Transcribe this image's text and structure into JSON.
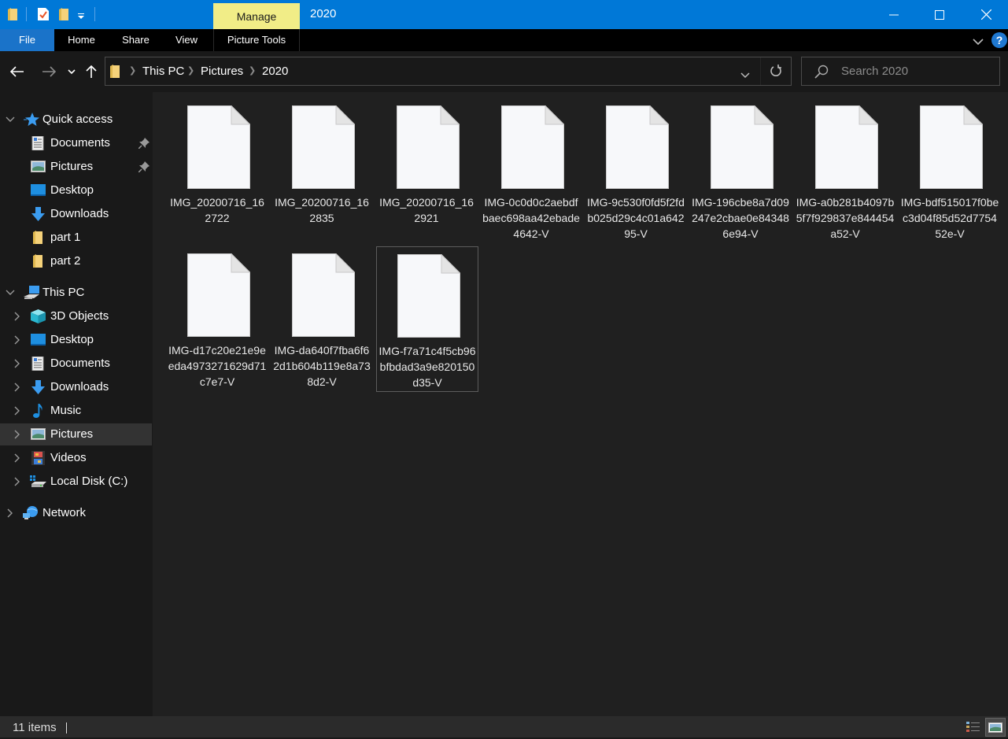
{
  "window": {
    "title": "2020",
    "contextual_tab_group": "Manage",
    "controls": {
      "minimize": "minimize",
      "maximize": "maximize",
      "close": "close"
    },
    "accent_color": "#0078d7",
    "contextual_color": "#f1ed87"
  },
  "quick_access_toolbar": {
    "icons": [
      "folder-icon",
      "properties-icon",
      "new-folder-icon",
      "customize-dropdown-icon"
    ]
  },
  "ribbon": {
    "tabs": [
      {
        "label": "File"
      },
      {
        "label": "Home"
      },
      {
        "label": "Share"
      },
      {
        "label": "View"
      },
      {
        "label": "Picture Tools"
      }
    ],
    "help_label": "?"
  },
  "navigation": {
    "back": "←",
    "forward": "→",
    "recent": "⌄",
    "up": "↑",
    "breadcrumb": [
      "This PC",
      "Pictures",
      "2020"
    ],
    "search_placeholder": "Search 2020"
  },
  "sidebar": {
    "quick_access": {
      "label": "Quick access",
      "items": [
        {
          "label": "Documents",
          "icon": "documents-icon",
          "pinned": true
        },
        {
          "label": "Pictures",
          "icon": "pictures-icon",
          "pinned": true
        },
        {
          "label": "Desktop",
          "icon": "desktop-icon",
          "pinned": false
        },
        {
          "label": "Downloads",
          "icon": "downloads-icon",
          "pinned": false
        },
        {
          "label": "part 1",
          "icon": "folder-icon",
          "pinned": false
        },
        {
          "label": "part 2",
          "icon": "folder-icon",
          "pinned": false
        }
      ]
    },
    "this_pc": {
      "label": "This PC",
      "items": [
        {
          "label": "3D Objects",
          "icon": "3d-objects-icon"
        },
        {
          "label": "Desktop",
          "icon": "desktop-icon"
        },
        {
          "label": "Documents",
          "icon": "documents-icon"
        },
        {
          "label": "Downloads",
          "icon": "downloads-icon"
        },
        {
          "label": "Music",
          "icon": "music-icon"
        },
        {
          "label": "Pictures",
          "icon": "pictures-icon",
          "selected": true
        },
        {
          "label": "Videos",
          "icon": "videos-icon"
        },
        {
          "label": "Local Disk (C:)",
          "icon": "local-disk-icon"
        }
      ]
    },
    "network": {
      "label": "Network"
    }
  },
  "files": [
    {
      "name": "IMG_20200716_162722"
    },
    {
      "name": "IMG_20200716_162835"
    },
    {
      "name": "IMG_20200716_162921"
    },
    {
      "name": "IMG-0c0d0c2aebdfbaec698aa42ebade4642-V"
    },
    {
      "name": "IMG-9c530f0fd5f2fdb025d29c4c01a64295-V"
    },
    {
      "name": "IMG-196cbe8a7d09247e2cbae0e843486e94-V"
    },
    {
      "name": "IMG-a0b281b4097b5f7f929837e844454a52-V"
    },
    {
      "name": "IMG-bdf515017f0bec3d04f85d52d775452e-V"
    },
    {
      "name": "IMG-d17c20e21e9eeda4973271629d71c7e7-V"
    },
    {
      "name": "IMG-da640f7fba6f62d1b604b119e8a738d2-V"
    },
    {
      "name": "IMG-f7a71c4f5cb96bfbdad3a9e820150d35-V",
      "focused": true
    }
  ],
  "status": {
    "item_count": "11 items"
  }
}
